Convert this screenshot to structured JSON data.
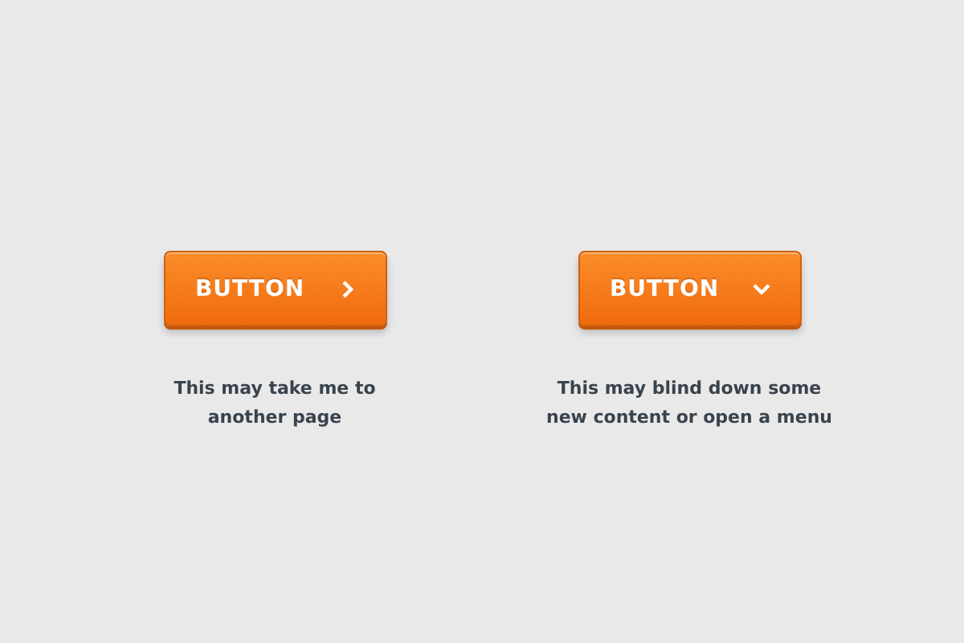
{
  "items": [
    {
      "button": {
        "label": "BUTTON",
        "kind": "link"
      },
      "caption": "This may take me to\nanother page"
    },
    {
      "button": {
        "label": "BUTTON",
        "kind": "dropdown"
      },
      "caption": "This may blind down some\nnew content or open a menu"
    }
  ]
}
